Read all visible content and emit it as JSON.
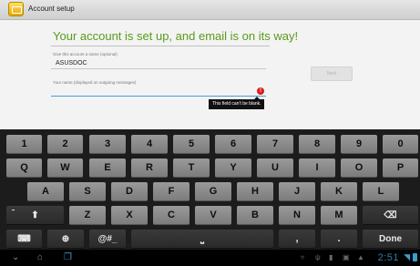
{
  "window": {
    "title": "Account setup"
  },
  "setup": {
    "heading": "Your account is set up, and email is on its way!",
    "account_name_label": "Give this account a name (optional)",
    "account_name_value": "ASUSDOC",
    "your_name_label": "Your name (displayed on outgoing messages)",
    "your_name_value": "",
    "next_label": "Next",
    "error_text": "This field can't be blank.",
    "error_icon_text": "!"
  },
  "keyboard": {
    "row1": [
      "1",
      "2",
      "3",
      "4",
      "5",
      "6",
      "7",
      "8",
      "9",
      "0"
    ],
    "row2": [
      "Q",
      "W",
      "E",
      "R",
      "T",
      "Y",
      "U",
      "I",
      "O",
      "P"
    ],
    "row3": [
      "A",
      "S",
      "D",
      "F",
      "G",
      "H",
      "J",
      "K",
      "L"
    ],
    "row4": [
      "Z",
      "X",
      "C",
      "V",
      "B",
      "N",
      "M"
    ],
    "shift_glyph": "⬆",
    "backspace_glyph": "⌫",
    "settings_glyph": "⌨",
    "globe_glyph": "⊕",
    "symbols_label": "@#_",
    "space_glyph": "⎵",
    "comma": ",",
    "period": ".",
    "done_label": "Done"
  },
  "status": {
    "time": "2:51",
    "back_glyph": "⌄",
    "home_glyph": "⌂",
    "recent_glyph": "❐"
  }
}
